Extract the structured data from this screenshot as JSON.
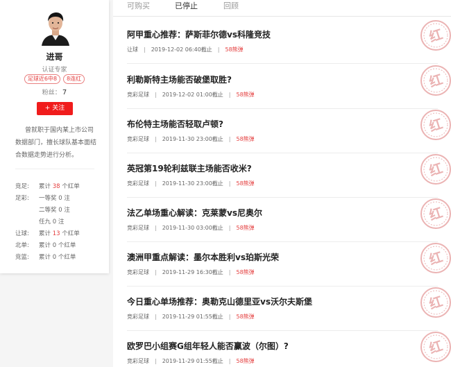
{
  "profile": {
    "name": "进哥",
    "cert": "认证专家",
    "badges": [
      "足球近6中8",
      "8连红"
    ],
    "fans_label": "粉丝：",
    "fans_count": "7",
    "follow_label": "+ 关注",
    "intro": "曾就职于国内某上市公司数据部门，擅长球队基本面结合数据走势进行分析。"
  },
  "stats": [
    {
      "label": "竞足:",
      "pre": "累计",
      "num": "38",
      "post": "个红单"
    },
    {
      "label": "足彩:",
      "pre": "一等奖",
      "num": "0",
      "post": "注"
    },
    {
      "label": "",
      "pre": "二等奖",
      "num": "0",
      "post": "注"
    },
    {
      "label": "",
      "pre": "任九",
      "num": "0",
      "post": "注"
    },
    {
      "label": "让球:",
      "pre": "累计",
      "num": "13",
      "post": "个红单"
    },
    {
      "label": "北单:",
      "pre": "累计",
      "num": "0",
      "post": "个红单"
    },
    {
      "label": "竞篮:",
      "pre": "累计",
      "num": "0",
      "post": "个红单"
    }
  ],
  "tabs": [
    "可购买",
    "已停止",
    "回顾"
  ],
  "active_tab": "已停止",
  "stamp_char": "红",
  "articles": [
    {
      "title": "阿甲重心推荐：萨斯菲尔德vs科隆竞技",
      "type": "让球",
      "deadline": "2019-12-02 06:40截止",
      "price": "58熊弹"
    },
    {
      "title": "利勒斯特主场能否破堡取胜?",
      "type": "竞彩足球",
      "deadline": "2019-12-02 01:00截止",
      "price": "58熊弹"
    },
    {
      "title": "布伦特主场能否轻取卢顿?",
      "type": "竞彩足球",
      "deadline": "2019-11-30 23:00截止",
      "price": "58熊弹"
    },
    {
      "title": "英冠第19轮利兹联主场能否收米?",
      "type": "竞彩足球",
      "deadline": "2019-11-30 23:00截止",
      "price": "58熊弹"
    },
    {
      "title": "法乙单场重心解读：克莱蒙vs尼奥尔",
      "type": "竞彩足球",
      "deadline": "2019-11-30 03:00截止",
      "price": "58熊弹"
    },
    {
      "title": "澳洲甲重点解读：墨尔本胜利vs珀斯光荣",
      "type": "竞彩足球",
      "deadline": "2019-11-29 16:30截止",
      "price": "58熊弹"
    },
    {
      "title": "今日重心单场推荐：奥勒克山德里亚vs沃尔夫斯堡",
      "type": "竞彩足球",
      "deadline": "2019-11-29 01:55截止",
      "price": "58熊弹"
    },
    {
      "title": "欧罗巴小组赛G组年轻人能否赢波（尔图）?",
      "type": "竞彩足球",
      "deadline": "2019-11-29 01:55截止",
      "price": "58熊弹"
    }
  ],
  "colors": {
    "accent": "#f01c1c",
    "price": "#e43d3d",
    "stamp": "#ebb3b3"
  }
}
